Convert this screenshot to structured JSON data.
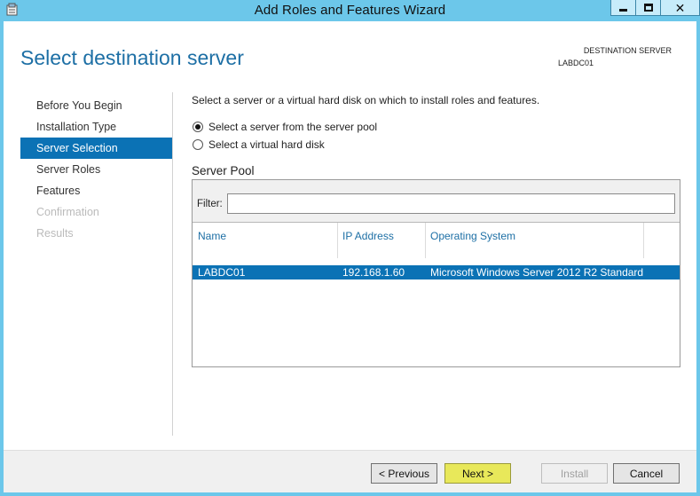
{
  "window": {
    "title": "Add Roles and Features Wizard",
    "close_glyph": "✕",
    "icon": "wizard-app-icon"
  },
  "page": {
    "title": "Select destination server",
    "destination_label": "DESTINATION SERVER",
    "destination_server": "LABDC01"
  },
  "nav": {
    "items": [
      {
        "label": "Before You Begin",
        "state": "normal"
      },
      {
        "label": "Installation Type",
        "state": "normal"
      },
      {
        "label": "Server Selection",
        "state": "active"
      },
      {
        "label": "Server Roles",
        "state": "normal"
      },
      {
        "label": "Features",
        "state": "normal"
      },
      {
        "label": "Confirmation",
        "state": "disabled"
      },
      {
        "label": "Results",
        "state": "disabled"
      }
    ]
  },
  "content": {
    "intro": "Select a server or a virtual hard disk on which to install roles and features.",
    "options": [
      {
        "label": "Select a server from the server pool",
        "checked": true
      },
      {
        "label": "Select a virtual hard disk",
        "checked": false
      }
    ],
    "pool_title": "Server Pool",
    "filter_label": "Filter:",
    "filter_value": "",
    "columns": [
      "Name",
      "IP Address",
      "Operating System"
    ],
    "rows": [
      {
        "name": "LABDC01",
        "ip": "192.168.1.60",
        "os": "Microsoft Windows Server 2012 R2 Standard",
        "selected": true
      }
    ]
  },
  "footer": {
    "previous": "< Previous",
    "next": "Next >",
    "install": "Install",
    "cancel": "Cancel"
  },
  "colors": {
    "title_bar": "#6cc7ea",
    "accent": "#0b72b5",
    "next_highlight": "#e8e85a"
  }
}
